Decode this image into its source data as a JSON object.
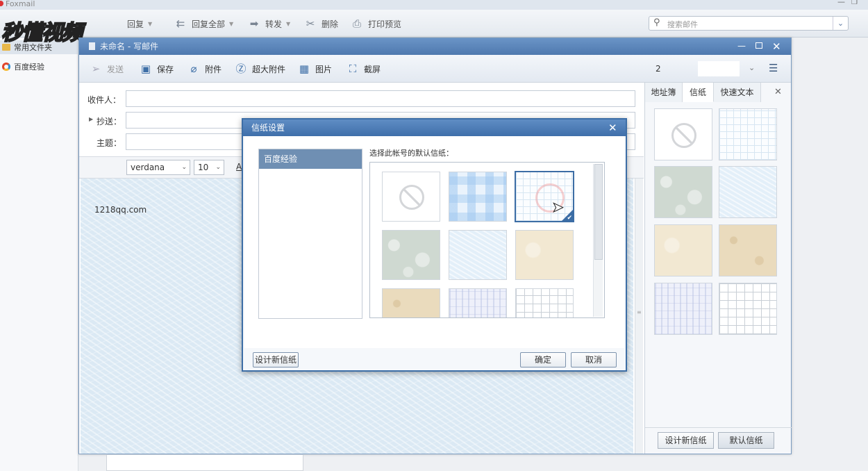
{
  "app": {
    "title": "Foxmail"
  },
  "watermark": {
    "text": "秒懂视频"
  },
  "main_toolbar": {
    "reply": "回复",
    "reply_all": "回复全部",
    "forward": "转发",
    "delete": "删除",
    "print_preview": "打印预览",
    "search_placeholder": "搜索邮件"
  },
  "left_pane": {
    "folders": [
      "常用文件夹",
      "百度经验"
    ]
  },
  "compose": {
    "title": "未命名 - 写邮件",
    "toolbar": {
      "send": "发送",
      "save": "保存",
      "attach": "附件",
      "large_attach": "超大附件",
      "picture": "图片",
      "screenshot": "截屏",
      "account_value": "2"
    },
    "fields": {
      "to_label": "收件人：",
      "cc_label": "抄送：",
      "subject_label": "主题："
    },
    "format": {
      "font": "verdana",
      "size": "10",
      "extra": "A"
    },
    "body_text": "1218qq.com"
  },
  "right_panel": {
    "tabs": [
      "地址簿",
      "信纸",
      "快速文本"
    ],
    "active_tab": "信纸",
    "design_button": "设计新信纸",
    "default_button": "默认信纸"
  },
  "dialog": {
    "title": "信纸设置",
    "accounts": [
      "百度经验"
    ],
    "prompt": "选择此帐号的默认信纸：",
    "design_button": "设计新信纸",
    "ok_button": "确定",
    "cancel_button": "取消"
  },
  "colors": {
    "title_blue": "#4f79ae",
    "dialog_blue": "#3f6faa",
    "selected_item": "#6f8fb3"
  }
}
